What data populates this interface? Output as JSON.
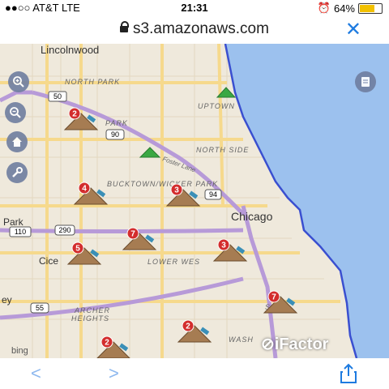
{
  "status": {
    "carrier": "●●○○ AT&T  LTE",
    "time": "21:31",
    "battery": "64%",
    "battery_level": 0.64
  },
  "browser": {
    "url": "s3.amazonaws.com"
  },
  "map": {
    "areas": {
      "lincolnwood": "Lincolnwood",
      "north_park": "NORTH PARK",
      "uptown": "UPTOWN",
      "albany_park": "PARK",
      "north_side": "NORTH SIDE",
      "foster_lane": "Foster Lane",
      "bucktown": "BUCKTOWN/WICKER PARK",
      "chicago": "Chicago",
      "park_left": "Park",
      "lower_west": "LOWER WES",
      "cicero": "Cice",
      "ey": "ey",
      "archer": "ARCHER",
      "heights": "HEIGHTS",
      "south_loop": "SOL",
      "washington": "WASH",
      "bing": "bing",
      "ifactor": "iFactor"
    },
    "routes": [
      "50",
      "90",
      "94",
      "110",
      "290",
      "55"
    ],
    "clusters": [
      {
        "count": "2",
        "type": "alert"
      },
      {
        "count": "4",
        "type": "alert"
      },
      {
        "count": "3",
        "type": "alert"
      },
      {
        "count": "7",
        "type": "alert"
      },
      {
        "count": "5",
        "type": "alert"
      },
      {
        "count": "3",
        "type": "alert"
      },
      {
        "count": "7",
        "type": "alert"
      },
      {
        "count": "2",
        "type": "alert"
      },
      {
        "count": "2",
        "type": "alert"
      }
    ],
    "colors": {
      "water": "#9cc1ee",
      "shore": "#3a4fd0",
      "land": "#efe9dc",
      "highway": "#f6d98c",
      "interstate": "#b79ad8",
      "tri_green": "#3aa843",
      "cluster": "#a67c52",
      "badge": "#d32d2d"
    }
  },
  "toolbar": {
    "zoom_in": "zoom-in",
    "zoom_out": "zoom-out",
    "home": "home",
    "tools": "wrench"
  },
  "nav": {
    "back": "<",
    "forward": ">"
  }
}
